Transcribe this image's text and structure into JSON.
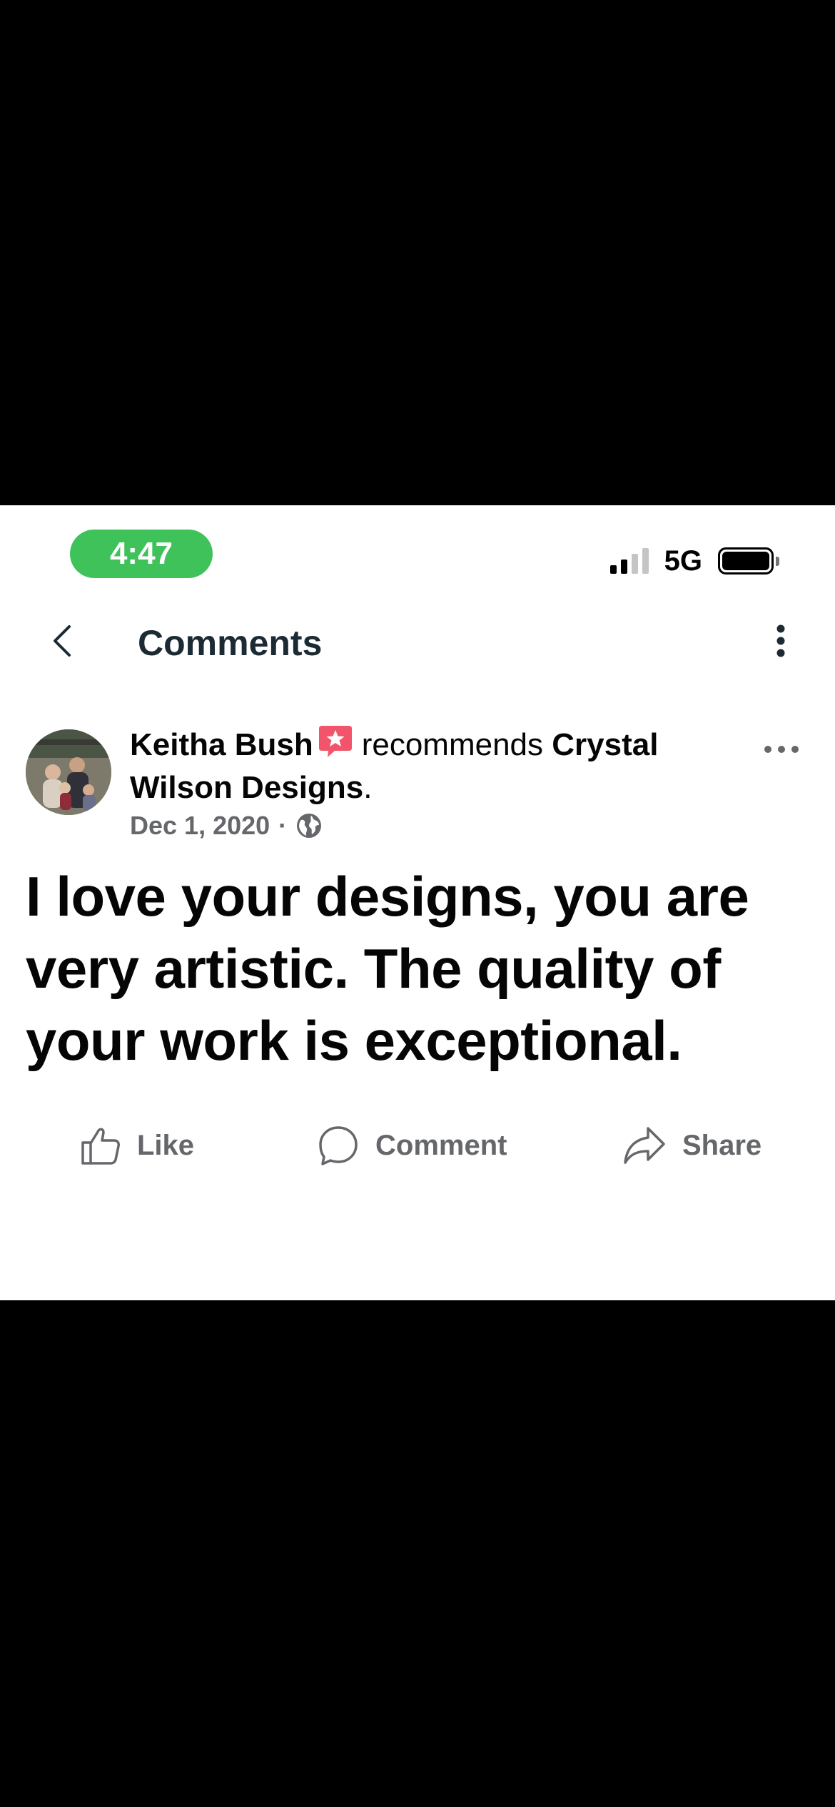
{
  "status_bar": {
    "time": "4:47",
    "network": "5G"
  },
  "header": {
    "title": "Comments"
  },
  "post": {
    "author": "Keitha Bush",
    "verb": "recommends",
    "page_name": "Crystal Wilson Designs",
    "period": ".",
    "date": "Dec 1, 2020",
    "separator": "·",
    "text": "I love your designs, you are very artistic. The quality of your work is exceptional."
  },
  "actions": {
    "like": "Like",
    "comment": "Comment",
    "share": "Share"
  },
  "colors": {
    "time_pill": "#3fc25a",
    "recommend_badge": "#f2556b",
    "muted_text": "#65676b"
  },
  "icons": [
    "back-chevron-icon",
    "more-vertical-icon",
    "more-horizontal-icon",
    "recommend-badge-icon",
    "globe-icon",
    "like-icon",
    "comment-icon",
    "share-icon",
    "battery-icon",
    "signal-icon"
  ]
}
